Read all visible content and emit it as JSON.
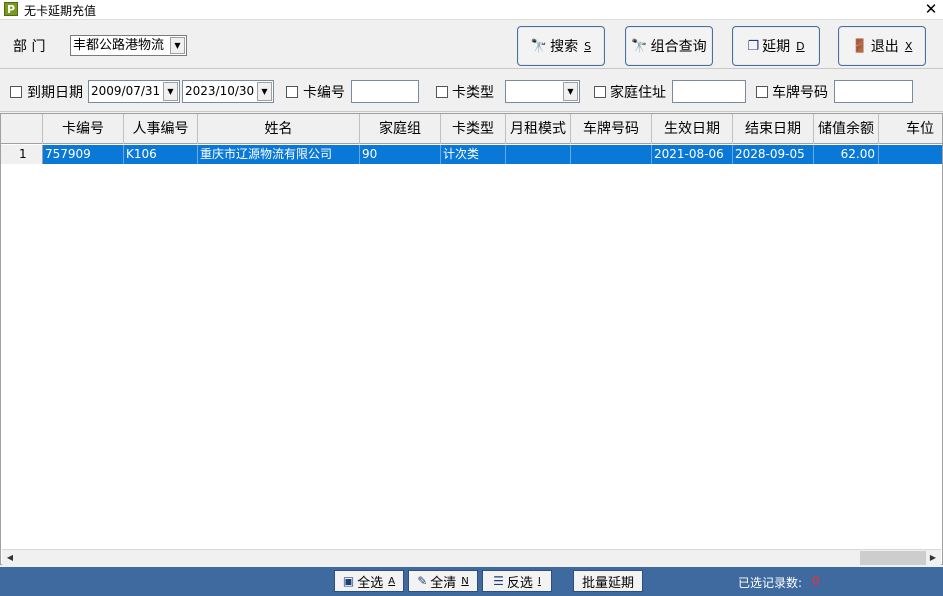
{
  "window": {
    "title": "无卡延期充值",
    "app_icon": "P"
  },
  "toolbar": {
    "dept_label": "部 门",
    "dept_value": "丰都公路港物流",
    "buttons": [
      {
        "label": "搜索",
        "key": "S"
      },
      {
        "label": "组合查询",
        "key": ""
      },
      {
        "label": "延期",
        "key": "D"
      },
      {
        "label": "退出",
        "key": "X"
      }
    ]
  },
  "filters": {
    "expire_label": "到期日期",
    "date_from": "2009/07/31",
    "date_to": "2023/10/30",
    "card_no_label": "卡编号",
    "card_no_value": "",
    "card_type_label": "卡类型",
    "card_type_value": "",
    "address_label": "家庭住址",
    "address_value": "",
    "plate_label": "车牌号码",
    "plate_value": ""
  },
  "table": {
    "columns": [
      "卡编号",
      "人事编号",
      "姓名",
      "家庭组",
      "卡类型",
      "月租模式",
      "车牌号码",
      "生效日期",
      "结束日期",
      "储值余额",
      "车位"
    ],
    "rows": [
      {
        "index": "1",
        "cells": [
          "757909",
          "K106",
          "重庆市辽源物流有限公司",
          "90",
          "计次类",
          "",
          "",
          "2021-08-06",
          "2028-09-05",
          "62.00",
          ""
        ]
      }
    ]
  },
  "statusbar": {
    "buttons": [
      {
        "label": "全选",
        "key": "A"
      },
      {
        "label": "全清",
        "key": "N"
      },
      {
        "label": "反选",
        "key": "I"
      },
      {
        "label": "批量延期",
        "key": ""
      }
    ],
    "selected_label": "已选记录数:",
    "selected_count": "0"
  },
  "colors": {
    "selection": "#0a78d7",
    "statusbar": "#3e6aa0",
    "count": "#ff2a2a"
  }
}
